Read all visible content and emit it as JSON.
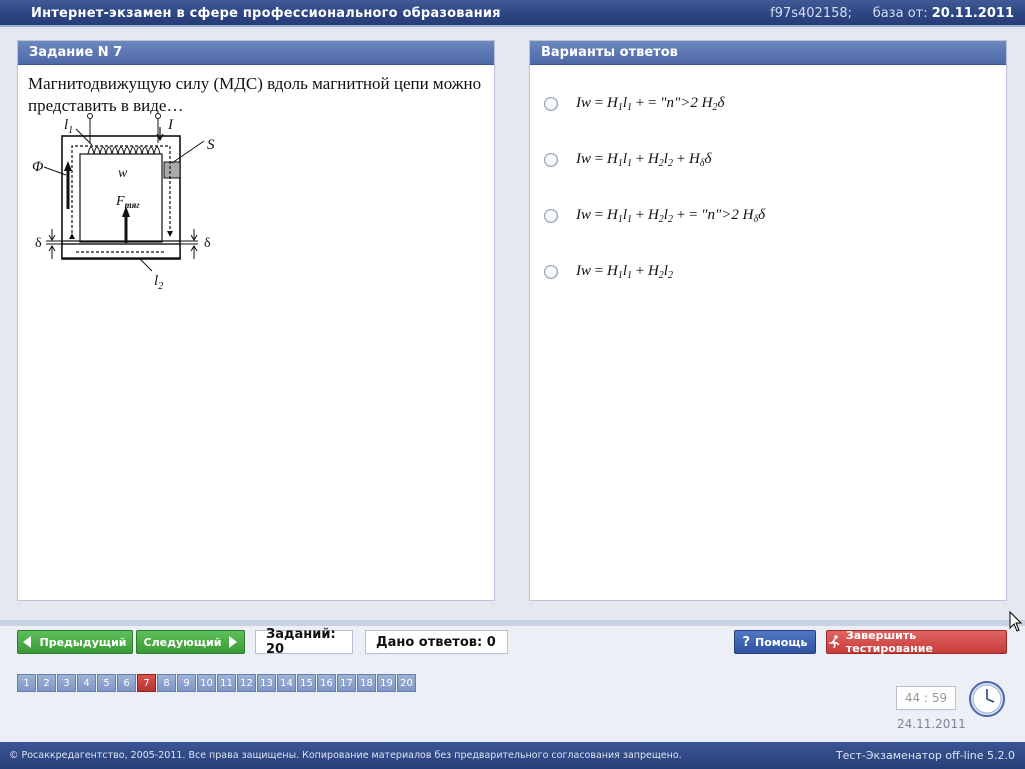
{
  "title_bar": {
    "app_title": "Интернет-экзамен в сфере профессионального образования",
    "session_id": "f97s402158;",
    "base_label": "база от:",
    "base_date": "20.11.2011"
  },
  "task_panel": {
    "header": "Задание N 7",
    "question": "Магнитодвижущую силу (МДС) вдоль магнитной цепи можно представить в виде…",
    "diagram_labels": {
      "l1": "l",
      "l1_sub": "1",
      "current": "I",
      "area": "S",
      "flux": "Φ",
      "turns": "w",
      "force": "F",
      "force_sub": "тяг",
      "gap_left": "δ",
      "gap_right": "δ",
      "l2": "l",
      "l2_sub": "2"
    }
  },
  "answers_panel": {
    "header": "Варианты ответов",
    "options": [
      "Iw = H1l1 + 2 H2δ",
      "Iw = H1l1 + H2l2 + Hδδ",
      "Iw = H1l1 + H2l2 + 2 Hδδ",
      "Iw = H1l1 + H2l2"
    ]
  },
  "navigation": {
    "prev_label": "Предыдущий",
    "next_label": "Следующий",
    "tasks_count": "Заданий: 20",
    "answers_count": "Дано ответов: 0",
    "help_label": "Помощь",
    "finish_label": "Завершить тестирование",
    "question_numbers": [
      "1",
      "2",
      "3",
      "4",
      "5",
      "6",
      "7",
      "8",
      "9",
      "10",
      "11",
      "12",
      "13",
      "14",
      "15",
      "16",
      "17",
      "18",
      "19",
      "20"
    ],
    "active_question": "7"
  },
  "status": {
    "timer": "44 : 59",
    "date": "24.11.2011"
  },
  "footer": {
    "copyright": "© Росаккредагентство, 2005-2011. Все права защищены. Копирование материалов без предварительного согласования запрещено.",
    "version": "Тест-Экзаменатор off-line 5.2.0"
  },
  "colors": {
    "title_bar": "#2c4582",
    "panel_header": "#5b76b1",
    "green_button": "#3a9a37",
    "blue_button": "#2f52a0",
    "red_button": "#c63b39",
    "active_number": "#c8403c"
  }
}
